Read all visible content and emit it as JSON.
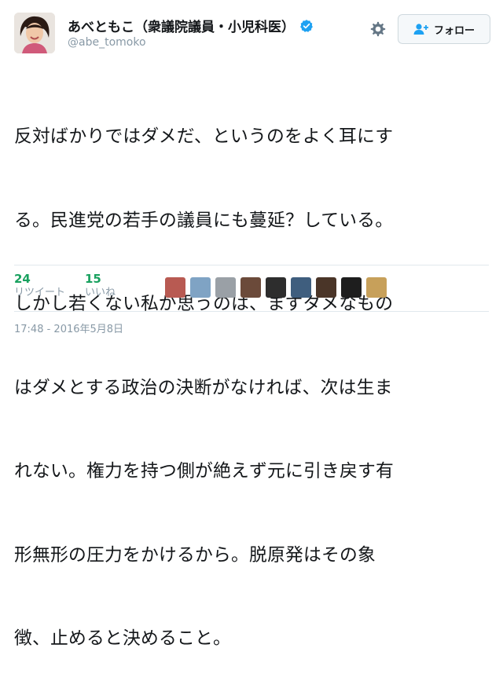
{
  "author": {
    "display_name": "あべともこ（衆議院議員・小児科医）",
    "handle": "@abe_tomoko",
    "verified_icon": "verified-badge-icon",
    "avatar_icon": "avatar"
  },
  "actions": {
    "settings_icon": "gear-icon",
    "follow_icon": "add-user-icon",
    "follow_label": "フォロー"
  },
  "tweet": {
    "lines": [
      "反対ばかりではダメだ、というのをよく耳にす",
      "る。民進党の若手の議員にも蔓延？している。",
      "しかし若くない私が思うのは、まずダメなもの",
      "はダメとする政治の決断がなければ、次は生ま",
      "れない。権力を持つ側が絶えず元に引き戻す有",
      "形無形の圧力をかけるから。脱原発はその象",
      "徴、止めると決めること。"
    ]
  },
  "stats": {
    "retweets": {
      "count": "24",
      "label": "リツイート"
    },
    "likes": {
      "count": "15",
      "label": "いいね"
    }
  },
  "likers": {
    "colors": [
      "#b85a52",
      "#7fa3c4",
      "#9aa0a6",
      "#6b4a3a",
      "#2d2d2d",
      "#3f5e7e",
      "#4a3528",
      "#1e1e1e",
      "#c7a05a"
    ]
  },
  "timestamp": "17:48 - 2016年5月8日"
}
